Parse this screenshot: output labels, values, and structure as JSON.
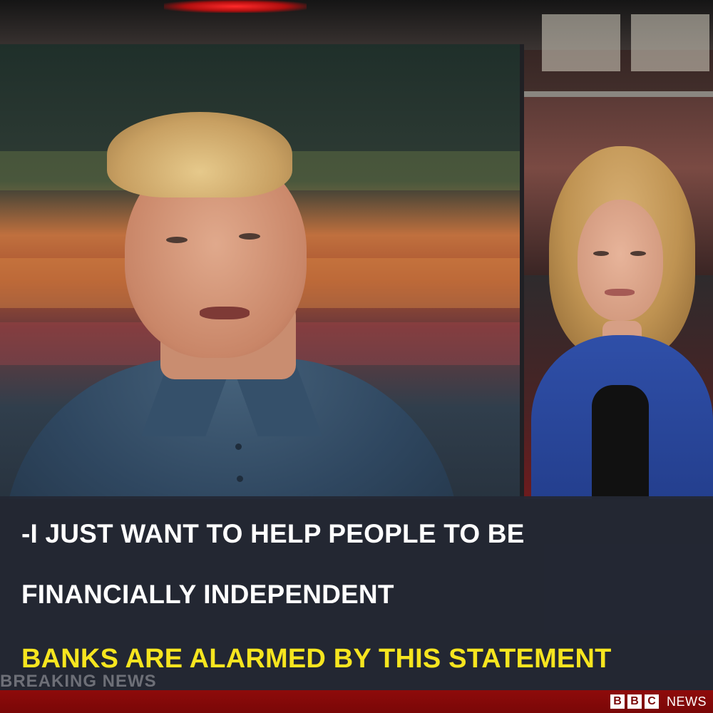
{
  "caption": {
    "line1": "-I JUST WANT TO HELP PEOPLE TO BE",
    "line2": "FINANCIALLY INDEPENDENT",
    "line3": "BANKS ARE ALARMED BY THIS STATEMENT"
  },
  "ticker": {
    "breaking_label": "BREAKING NEWS"
  },
  "branding": {
    "logo_letters": [
      "B",
      "B",
      "C"
    ],
    "logo_word": "NEWS"
  },
  "colors": {
    "caption_text": "#ffffff",
    "headline_highlight": "#f6e51f",
    "brand_red": "#7a0707",
    "caption_panel": "#242834"
  }
}
